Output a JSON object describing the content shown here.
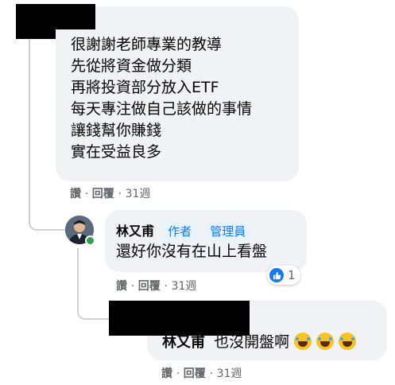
{
  "comment1": {
    "lines": [
      "很謝謝老師專業的教導",
      "先從將資金做分類",
      "再將投資部分放入ETF",
      "每天專注做自己該做的事情",
      "讓錢幫你賺錢",
      "實在受益良多"
    ],
    "like_label": "讚",
    "reply_label": "回覆",
    "time": "31週"
  },
  "reply1": {
    "author": "林又甫",
    "badges": [
      "作者",
      "管理員"
    ],
    "text": "還好你沒有在山上看盤",
    "reaction_count": "1",
    "like_label": "讚",
    "reply_label": "回覆",
    "time": "31週"
  },
  "reply2": {
    "mention": "林又甫",
    "text": "也沒開盤啊",
    "emoji_icons": [
      "rolling-on-floor-laughing",
      "rolling-on-floor-laughing",
      "rolling-on-floor-laughing"
    ],
    "like_label": "讚",
    "reply_label": "回覆",
    "time": "31週"
  },
  "colors": {
    "bubble": "#f0f2f5",
    "accent": "#1877f2",
    "badge_bg": "#e7f3ff",
    "meta_text": "#65676b",
    "online": "#31a24c"
  }
}
